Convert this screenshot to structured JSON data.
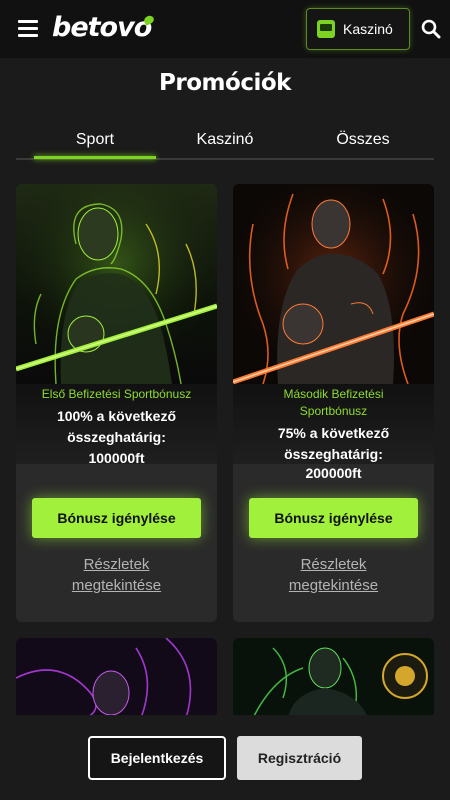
{
  "header": {
    "logo_text": "betovo",
    "casino_button_label": "Kaszinó"
  },
  "page": {
    "title": "Promóciók"
  },
  "tabs": [
    {
      "label": "Sport",
      "active": true
    },
    {
      "label": "Kaszinó",
      "active": false
    },
    {
      "label": "Összes",
      "active": false
    }
  ],
  "promos": [
    {
      "tag": "Első Befizetési Sportbónusz",
      "description": [
        "100% a következő",
        "összeghatárig:",
        "100000ft"
      ],
      "claim_label": "Bónusz igénylése",
      "details_label": [
        "Részletek",
        "megtekintése"
      ]
    },
    {
      "tag": [
        "Második Befizetési",
        "Sportbónusz"
      ],
      "description": [
        "75% a következő",
        "összeghatárig:",
        "200000ft"
      ],
      "claim_label": "Bónusz igénylése",
      "details_label": [
        "Részletek",
        "megtekintése"
      ]
    }
  ],
  "footer": {
    "login_label": "Bejelentkezés",
    "register_label": "Regisztráció"
  },
  "colors": {
    "accent": "#a0f03c",
    "accent_dark": "#7cd322",
    "background": "#1b1b1b",
    "card": "#2a2a2a"
  }
}
